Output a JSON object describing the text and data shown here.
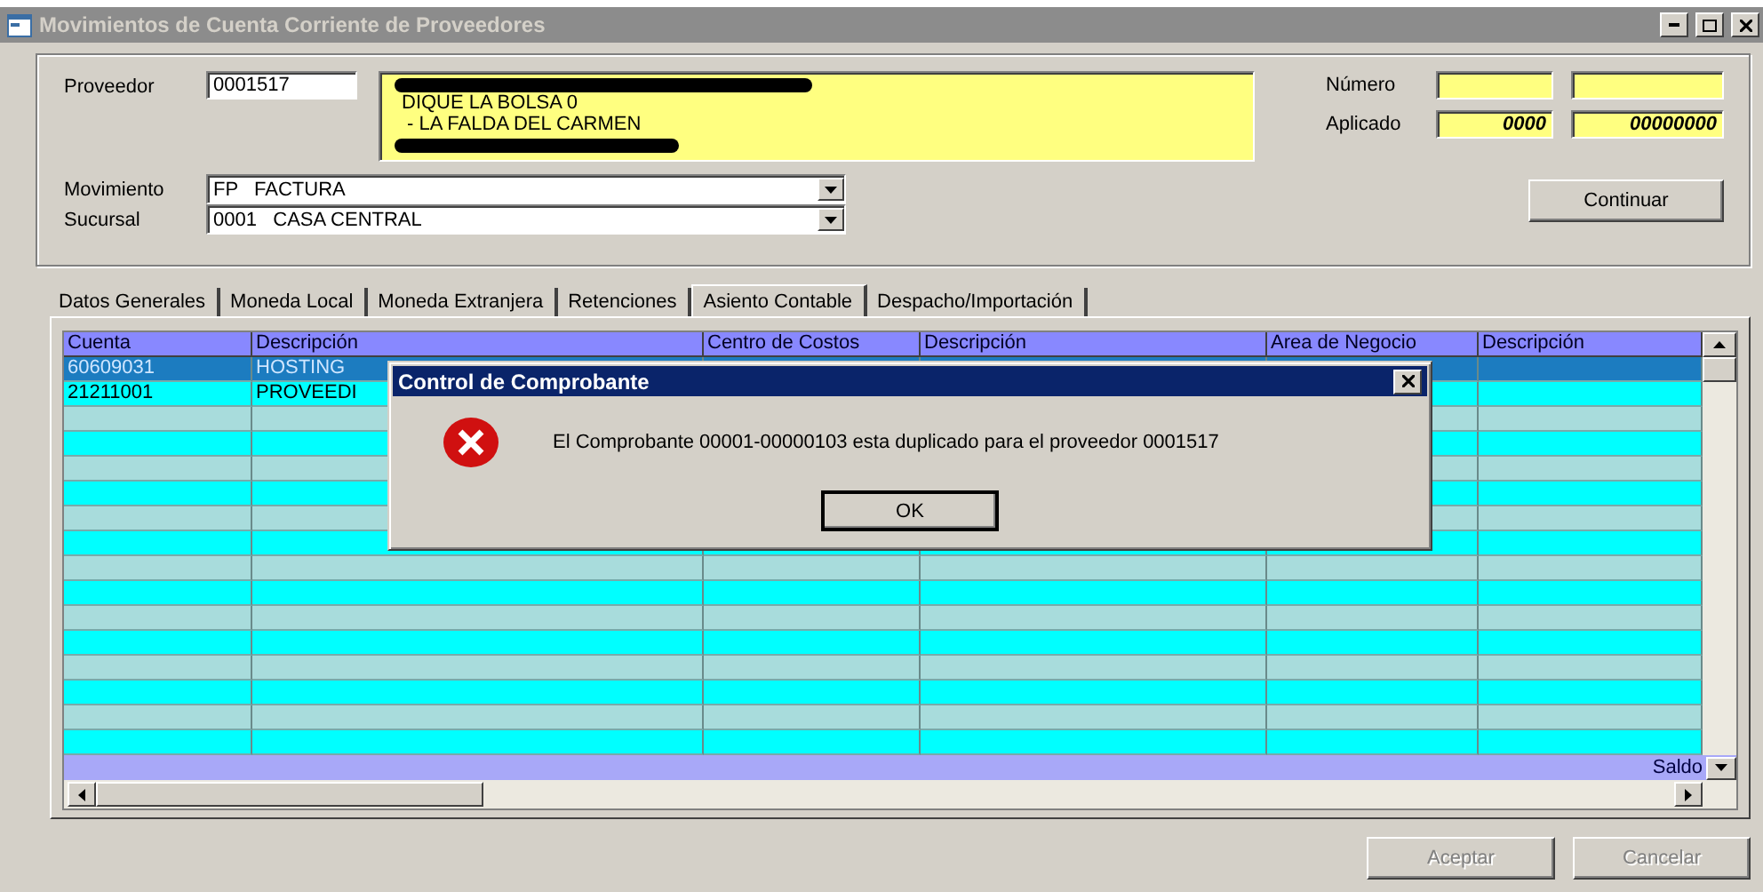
{
  "window": {
    "title": "Movimientos de Cuenta Corriente de Proveedores",
    "active": false
  },
  "header": {
    "proveedor_label": "Proveedor",
    "proveedor_code": "0001517",
    "address_lines": [
      {
        "kind": "redacted"
      },
      {
        "kind": "text",
        "text": "DIQUE LA BOLSA 0"
      },
      {
        "kind": "text",
        "text": " - LA FALDA DEL CARMEN"
      },
      {
        "kind": "redacted"
      }
    ],
    "numero_label": "Número",
    "aplicado_label": "Aplicado",
    "aplicado_values": [
      "0000",
      "00000000"
    ],
    "movimiento_label": "Movimiento",
    "movimiento_value": "FP   FACTURA",
    "sucursal_label": "Sucursal",
    "sucursal_value": "0001   CASA CENTRAL",
    "continue_button": "Continuar"
  },
  "tabs": [
    {
      "label": "Datos Generales",
      "selected": false
    },
    {
      "label": "Moneda Local",
      "selected": false
    },
    {
      "label": "Moneda Extranjera",
      "selected": false
    },
    {
      "label": "Retenciones",
      "selected": false
    },
    {
      "label": "Asiento Contable",
      "selected": true
    },
    {
      "label": "Despacho/Importación",
      "selected": false
    }
  ],
  "table": {
    "columns": [
      "Cuenta",
      "Descripción",
      "Centro de Costos",
      "Descripción",
      "Area de Negocio",
      "Descripción"
    ],
    "rows": [
      {
        "selected": true,
        "cells": [
          "60609031",
          "HOSTING"
        ]
      },
      {
        "selected": false,
        "cells": [
          "21211001",
          "PROVEEDI"
        ]
      },
      {
        "selected": false
      },
      {
        "selected": false
      },
      {
        "selected": false
      },
      {
        "selected": false
      },
      {
        "selected": false
      },
      {
        "selected": false
      },
      {
        "selected": false
      },
      {
        "selected": false
      },
      {
        "selected": false
      },
      {
        "selected": false
      },
      {
        "selected": false
      },
      {
        "selected": false
      },
      {
        "selected": false
      },
      {
        "selected": false
      }
    ],
    "footer_label": "Saldo"
  },
  "buttons": [
    {
      "label": "Aceptar",
      "disabled": true
    },
    {
      "label": "Cancelar",
      "disabled": true
    }
  ],
  "dialog": {
    "title": "Control de Comprobante",
    "message": "El Comprobante 00001-00000103 esta duplicado para el proveedor 0001517",
    "button": "OK"
  }
}
